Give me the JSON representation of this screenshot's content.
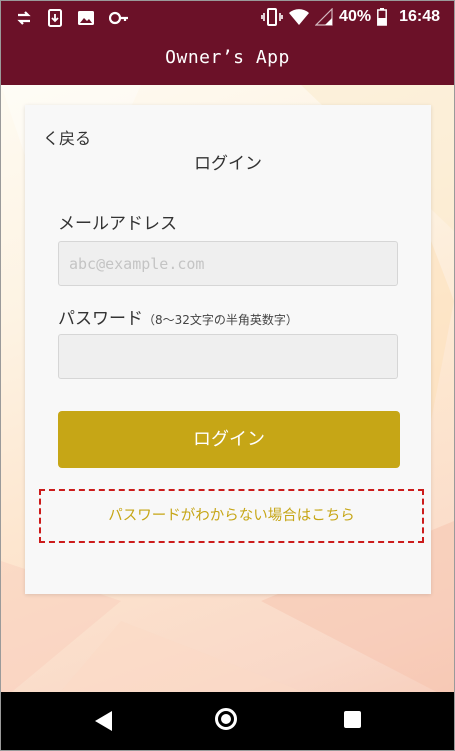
{
  "status_bar": {
    "battery_percent": "40%",
    "time": "16:48",
    "icons": [
      "data-sync-icon",
      "app-download-icon",
      "image-icon",
      "key-icon",
      "vibrate-icon",
      "wifi-icon",
      "signal-icon",
      "battery-icon"
    ]
  },
  "app_bar": {
    "title": "Owner’s App"
  },
  "login_card": {
    "back_label": "く戻る",
    "title": "ログイン",
    "email_label": "メールアドレス",
    "email_value": "",
    "email_placeholder": "abc@example.com",
    "password_label": "パスワード",
    "password_hint": "（8〜32文字の半角英数字）",
    "password_value": "",
    "password_placeholder": "",
    "login_button": "ログイン",
    "forgot_link": "パスワードがわからない場合はこちら"
  },
  "nav_bar": {
    "buttons": [
      "back",
      "home",
      "recent-apps"
    ]
  },
  "colors": {
    "header": "#6b1128",
    "accent_gold": "#c6a616",
    "highlight_dashed": "#cc1b1b"
  }
}
